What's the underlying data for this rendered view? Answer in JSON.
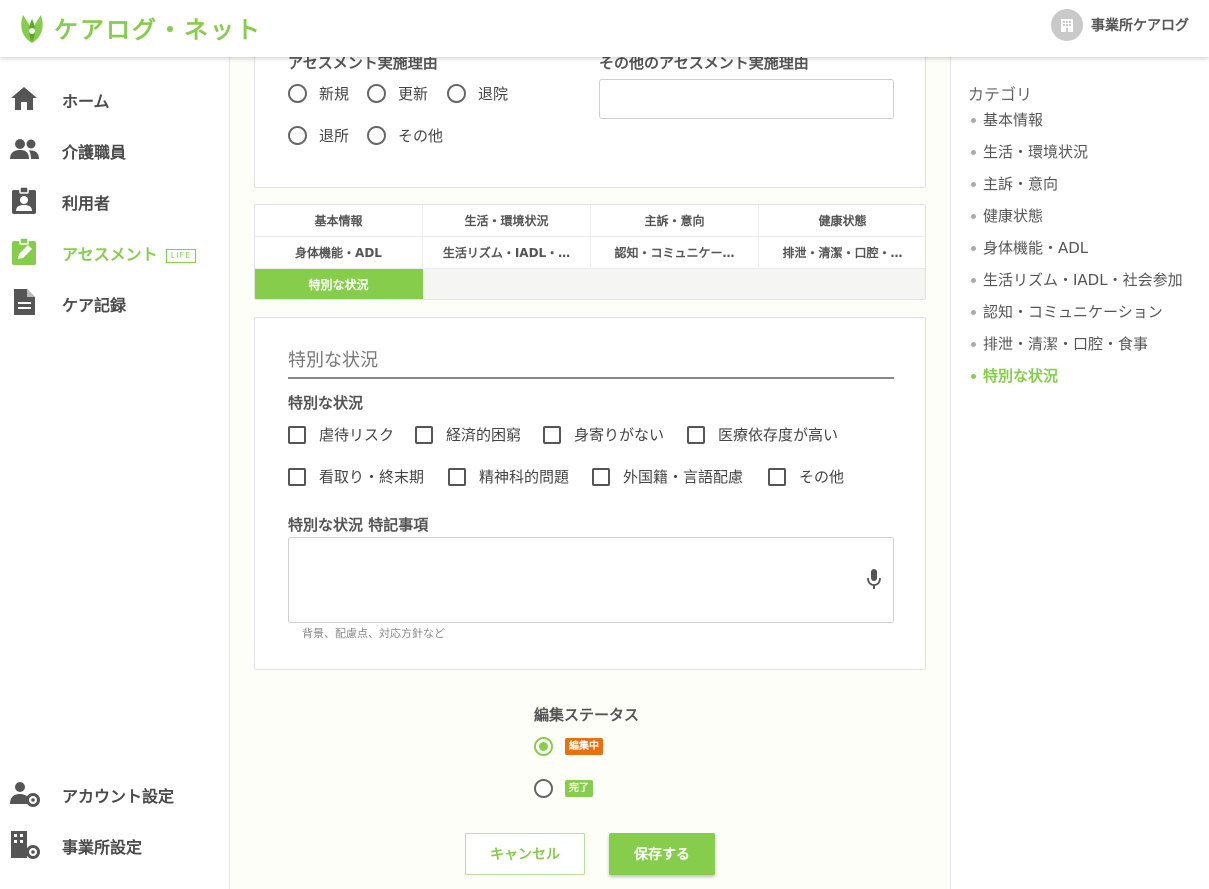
{
  "app": {
    "title": "ケアログ・ネット",
    "office_name": "事業所ケアログ"
  },
  "colors": {
    "accent": "#86cd4c",
    "badge_editing": "#e8700f",
    "badge_done": "#86cd4c"
  },
  "sidebar": {
    "items": [
      {
        "label": "ホーム",
        "icon": "home-icon"
      },
      {
        "label": "介護職員",
        "icon": "staff-icon"
      },
      {
        "label": "利用者",
        "icon": "user-badge-icon"
      },
      {
        "label": "アセスメント",
        "icon": "edit-note-icon",
        "badge": "LIFE",
        "active": true
      },
      {
        "label": "ケア記録",
        "icon": "document-icon"
      }
    ],
    "bottom_items": [
      {
        "label": "アカウント設定",
        "icon": "account-settings-icon"
      },
      {
        "label": "事業所設定",
        "icon": "office-settings-icon"
      }
    ]
  },
  "reason": {
    "label": "アセスメント実施理由",
    "options": [
      "新規",
      "更新",
      "退院",
      "退所",
      "その他"
    ],
    "other_label": "その他のアセスメント実施理由",
    "other_value": ""
  },
  "tabs": [
    "基本情報",
    "生活・環境状況",
    "主訴・意向",
    "健康状態",
    "身体機能・ADL",
    "生活リズム・IADL・…",
    "認知・コミュニケー…",
    "排泄・清潔・口腔・…",
    "特別な状況"
  ],
  "active_tab_index": 8,
  "section": {
    "title": "特別な状況",
    "checklist_label": "特別な状況",
    "checks": [
      "虐待リスク",
      "経済的困窮",
      "身寄りがない",
      "医療依存度が高い",
      "看取り・終末期",
      "精神科的問題",
      "外国籍・言語配慮",
      "その他"
    ],
    "notes_label": "特別な状況 特記事項",
    "notes_value": "",
    "notes_hint": "背景、配慮点、対応方針など"
  },
  "status": {
    "label": "編集ステータス",
    "options": [
      {
        "label": "編集中",
        "selected": true
      },
      {
        "label": "完了",
        "selected": false
      }
    ]
  },
  "buttons": {
    "cancel": "キャンセル",
    "save": "保存する"
  },
  "categories": {
    "title": "カテゴリ",
    "items": [
      "基本情報",
      "生活・環境状況",
      "主訴・意向",
      "健康状態",
      "身体機能・ADL",
      "生活リズム・IADL・社会参加",
      "認知・コミュニケーション",
      "排泄・清潔・口腔・食事",
      "特別な状況"
    ],
    "active_index": 8
  }
}
